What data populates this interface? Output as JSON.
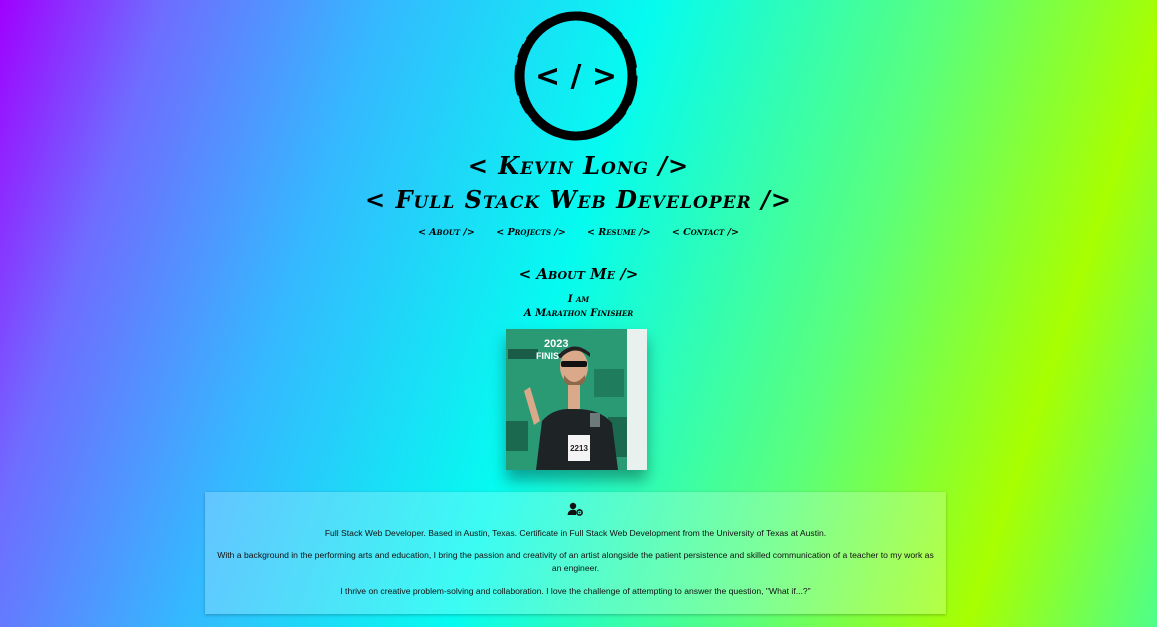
{
  "logo": {
    "text": "< / >"
  },
  "hero": {
    "name": "< Kevin Long />",
    "title": "< Full Stack Web Developer />"
  },
  "nav": {
    "about": "< About />",
    "projects": "< Projects />",
    "resume": "< Resume />",
    "contact": "< Contact />"
  },
  "about_section": {
    "heading": "< About Me />",
    "intro": "I am",
    "role": "A Marathon Finisher",
    "photo_banner": {
      "year": "2023",
      "finisher": "FINISHER",
      "bib": "2213"
    },
    "paragraphs": [
      "Full Stack Web Developer. Based in Austin, Texas. Certificate in Full Stack Web Development from the University of Texas at Austin.",
      "With a background in the performing arts and education, I bring the passion and creativity of an artist alongside the patient persistence and skilled communication of a teacher to my work as an engineer.",
      "I thrive on creative problem-solving and collaboration. I love the challenge of attempting to answer the question, \"What if...?\""
    ]
  }
}
